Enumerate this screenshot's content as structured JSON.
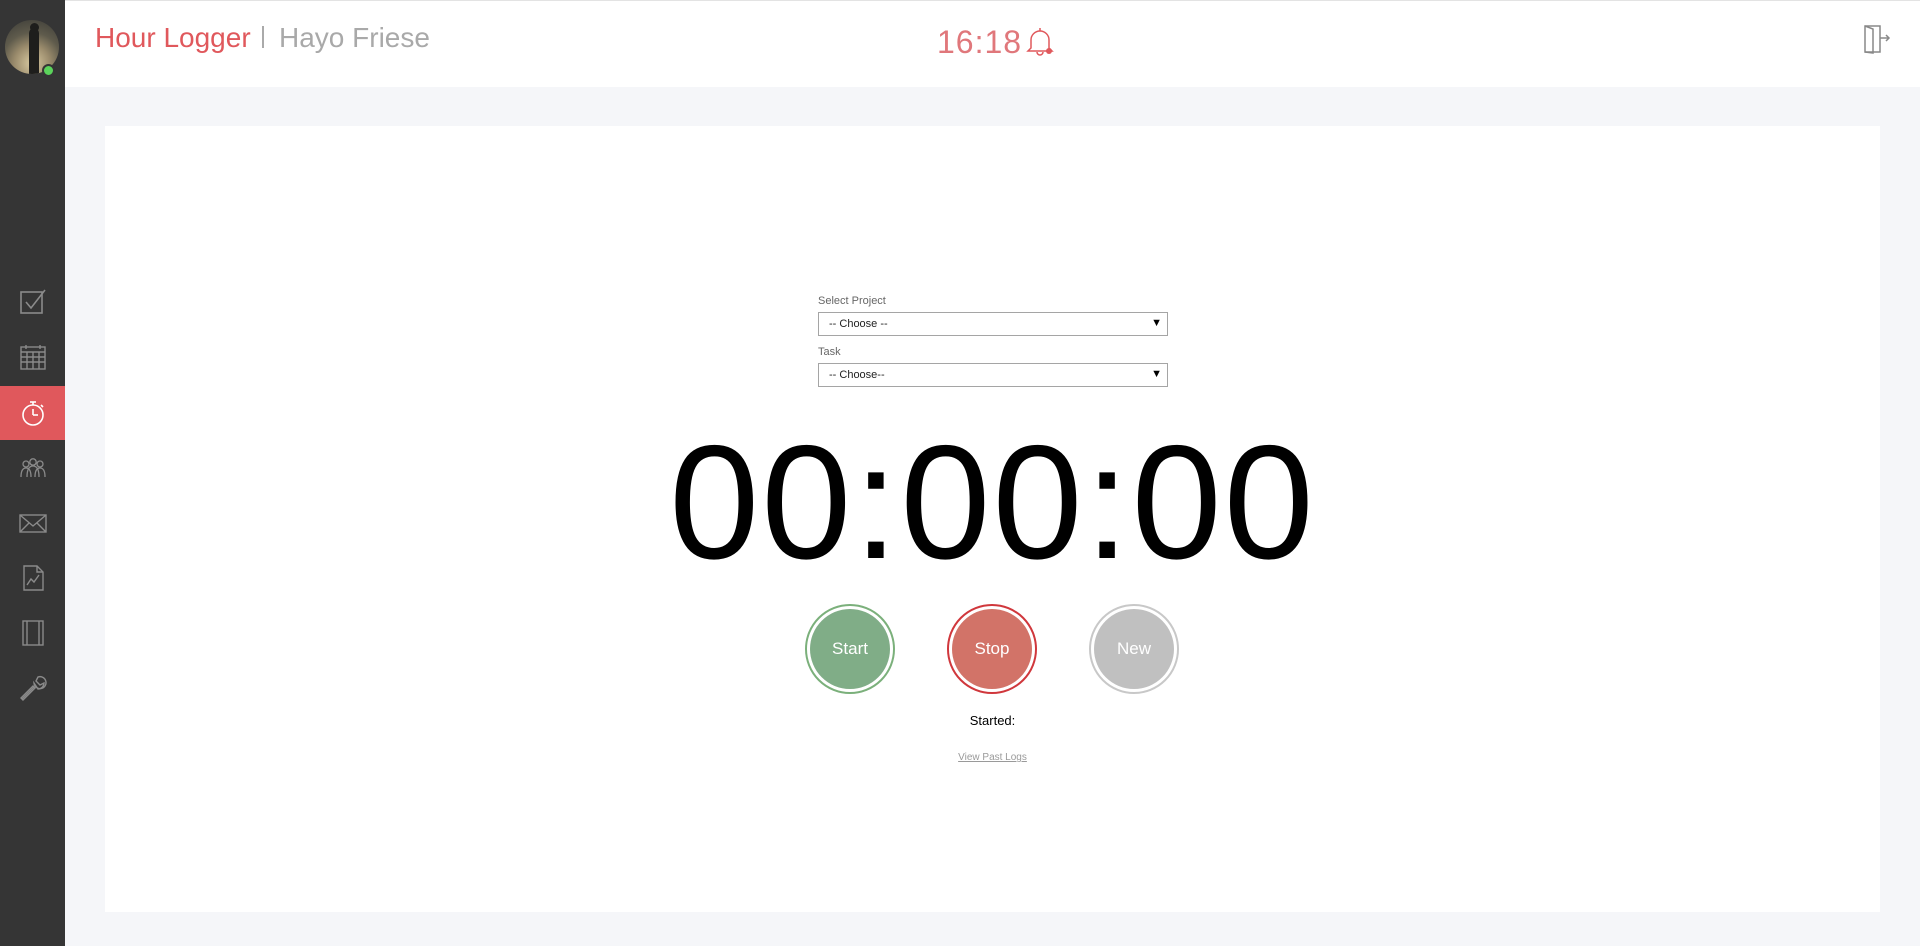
{
  "app": {
    "title": "Hour Logger",
    "user": "Hayo Friese",
    "clock": "16:18"
  },
  "sidebar": {
    "items": [
      {
        "icon": "checkbox-icon",
        "active": false
      },
      {
        "icon": "calendar-icon",
        "active": false
      },
      {
        "icon": "stopwatch-icon",
        "active": true
      },
      {
        "icon": "team-icon",
        "active": false
      },
      {
        "icon": "mail-icon",
        "active": false
      },
      {
        "icon": "report-chart-icon",
        "active": false
      },
      {
        "icon": "notebook-icon",
        "active": false
      },
      {
        "icon": "wrench-icon",
        "active": false
      }
    ]
  },
  "form": {
    "project_label": "Select Project",
    "project_value": "-- Choose --",
    "task_label": "Task",
    "task_value": "-- Choose--"
  },
  "timer": {
    "display": "00:00:00"
  },
  "controls": {
    "start_label": "Start",
    "stop_label": "Stop",
    "new_label": "New"
  },
  "status": {
    "started_label": "Started:",
    "started_value": ""
  },
  "links": {
    "past_logs": "View Past Logs"
  },
  "colors": {
    "accent": "#e0585c",
    "sidebar": "#353535",
    "start": "#80ad87",
    "stop": "#d27368",
    "new": "#c0c0c0"
  }
}
